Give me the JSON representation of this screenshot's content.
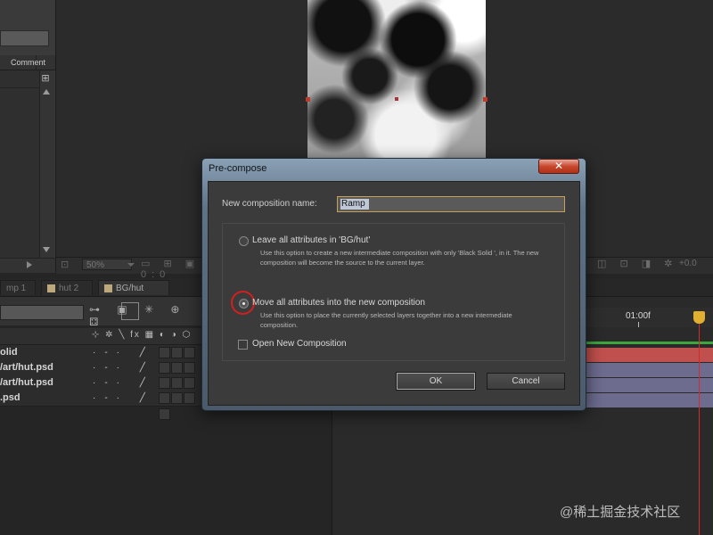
{
  "project_panel": {
    "comment_header": "Comment",
    "icons": {
      "flowchart": "flowchart-icon",
      "scroll_up": "arrow-up-icon",
      "scroll_down": "arrow-down-icon"
    }
  },
  "viewer": {
    "zoom_value": "50%",
    "timecode_partial": "0:0",
    "exposure_value": "+0.0",
    "icons_mid": "▭ ⊞ ▣",
    "icons_right": "◫ ⊡ ◨ ✲"
  },
  "timeline": {
    "tabs": [
      "mp 1",
      "hut 2",
      "BG/hut"
    ],
    "toolbar_icons": "⊶ ▣ ✳ ⊕ ⚃",
    "switch_header": "⊹ ✲ ╲ fx ▦ ◐ ◑ ⬡",
    "layers": [
      {
        "name": "olid",
        "switch": "·-·  ╱ fx"
      },
      {
        "name": "/art/hut.psd",
        "switch": "·-·  ╱"
      },
      {
        "name": "/art/hut.psd",
        "switch": "·-·  ╱"
      },
      {
        "name": ".psd",
        "switch": "·-·  ╱"
      }
    ],
    "ruler_label": "01:00f",
    "accent": {
      "work_area": "#3da63d",
      "track_selected": "#c0504d",
      "track": "#6d6b8e",
      "cti": "#d42a2a"
    }
  },
  "dialog": {
    "title": "Pre-compose",
    "close_label": "✕",
    "name_label": "New composition name:",
    "name_value": "Ramp",
    "option_leave_label": "Leave all attributes in 'BG/hut'",
    "option_leave_desc": "Use this option to create a new intermediate composition with only 'Black Solid ', in it. The new composition will become the source to the current layer.",
    "option_move_label": "Move all attributes into the new composition",
    "option_move_desc": "Use this option to place the currently selected layers together into a new intermediate composition.",
    "selected_option": "move",
    "checkbox_label": "Open New Composition",
    "checkbox_checked": false,
    "ok_label": "OK",
    "cancel_label": "Cancel",
    "highlight_color": "#d41f1f"
  },
  "watermark": "@稀土掘金技术社区"
}
